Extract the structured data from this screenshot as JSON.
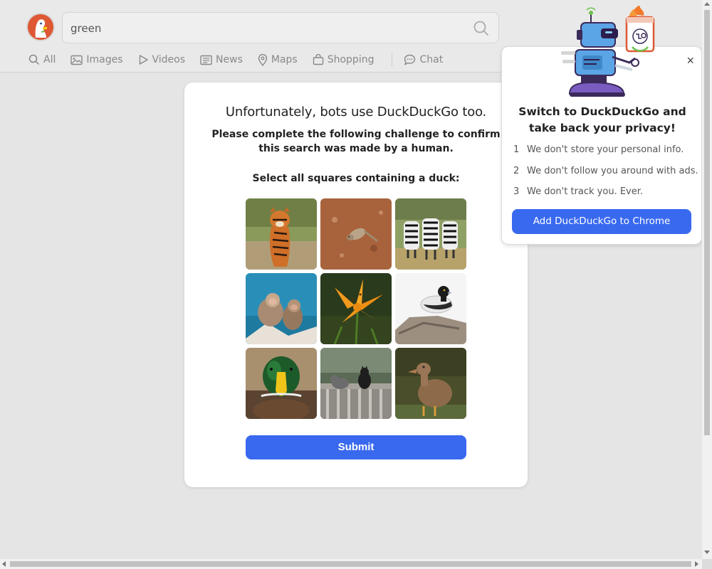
{
  "search": {
    "query": "green"
  },
  "nav": {
    "items": [
      {
        "label": "All",
        "icon": "search-icon"
      },
      {
        "label": "Images",
        "icon": "image-icon"
      },
      {
        "label": "Videos",
        "icon": "play-icon"
      },
      {
        "label": "News",
        "icon": "newspaper-icon"
      },
      {
        "label": "Maps",
        "icon": "map-pin-icon"
      },
      {
        "label": "Shopping",
        "icon": "shopping-bag-icon"
      }
    ],
    "chat": {
      "label": "Chat",
      "icon": "chat-bubble-icon"
    }
  },
  "challenge": {
    "title": "Unfortunately, bots use DuckDuckGo too.",
    "subtitle": "Please complete the following challenge to confirm this search was made by a human.",
    "instruction": "Select all squares containing a duck:",
    "tiles": [
      {
        "subject": "tiger"
      },
      {
        "subject": "meerkat"
      },
      {
        "subject": "zebras"
      },
      {
        "subject": "monkeys"
      },
      {
        "subject": "orange-lily"
      },
      {
        "subject": "duck-on-driftwood"
      },
      {
        "subject": "mallard-duck"
      },
      {
        "subject": "cats-on-bench"
      },
      {
        "subject": "brown-duck"
      }
    ],
    "submit_label": "Submit"
  },
  "promo": {
    "title_line1": "Switch to DuckDuckGo and",
    "title_line2": "take back your privacy!",
    "points": [
      {
        "num": "1",
        "text": "We don't store your personal info."
      },
      {
        "num": "2",
        "text": "We don't follow you around with ads."
      },
      {
        "num": "3",
        "text": "We don't track you. Ever."
      }
    ],
    "button_label": "Add DuckDuckGo to Chrome",
    "close_label": "×"
  },
  "colors": {
    "accent": "#3969ef",
    "background": "#e5e5e5",
    "logo": "#de5833"
  }
}
